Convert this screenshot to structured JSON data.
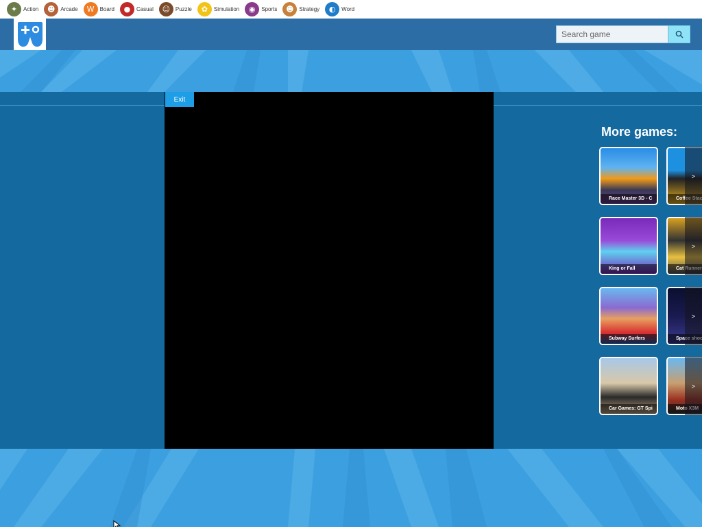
{
  "categories": [
    {
      "label": "Action",
      "icon": "action-icon",
      "color": "#6b7b4a",
      "glyph": "✦"
    },
    {
      "label": "Arcade",
      "icon": "arcade-icon",
      "color": "#b4623a",
      "glyph": "☻"
    },
    {
      "label": "Board",
      "icon": "board-icon",
      "color": "#f07a22",
      "glyph": "W"
    },
    {
      "label": "Casual",
      "icon": "casual-icon",
      "color": "#c22a2a",
      "glyph": "●"
    },
    {
      "label": "Puzzle",
      "icon": "puzzle-icon",
      "color": "#7a4a2a",
      "glyph": "☺"
    },
    {
      "label": "Simulation",
      "icon": "simulation-icon",
      "color": "#f2c418",
      "glyph": "✿"
    },
    {
      "label": "Sports",
      "icon": "sports-icon",
      "color": "#8a3a8a",
      "glyph": "◉"
    },
    {
      "label": "Strategy",
      "icon": "strategy-icon",
      "color": "#c7813a",
      "glyph": "☻"
    },
    {
      "label": "Word",
      "icon": "word-icon",
      "color": "#1e7cc8",
      "glyph": "◐"
    }
  ],
  "search": {
    "placeholder": "Search game"
  },
  "player": {
    "exit_label": "Exit"
  },
  "sidebar": {
    "title": "More games:",
    "games": [
      {
        "title": "Race Master 3D - C",
        "column": 1,
        "art": "linear-gradient(180deg,#2a8de6 0%,#5fb3f0 35%,#f29a18 55%,#3a3a55 75%,#6a3a8a 100%)"
      },
      {
        "title": "Coffee Stack",
        "column": 2,
        "art": "linear-gradient(180deg,#1e90e0 0%,#1e90e0 40%,#222 55%,#e8b020 100%)"
      },
      {
        "title": "King or Fall",
        "column": 1,
        "art": "linear-gradient(180deg,#7a2ab8 0%,#9a4ad8 40%,#5fd0f0 60%,#7a2ab8 100%)"
      },
      {
        "title": "Cat Runner",
        "column": 2,
        "art": "linear-gradient(180deg,#d8a020 0%,#333 40%,#e8c040 70%,#555 100%)"
      },
      {
        "title": "Subway Surfers",
        "column": 1,
        "art": "linear-gradient(180deg,#6ab8f0 0%,#8a6ad0 35%,#e8a060 55%,#d83030 80%,#2a5ab0 100%)"
      },
      {
        "title": "Space shooter",
        "column": 2,
        "art": "linear-gradient(180deg,#0a1030 0%,#1a1a50 50%,#3a3a90 100%)"
      },
      {
        "title": "Car Games: GT Spi",
        "column": 1,
        "art": "linear-gradient(180deg,#a8c8e8 0%,#d8c8a8 45%,#2a2a2a 70%,#b8a080 100%)"
      },
      {
        "title": "Moto X3M",
        "column": 2,
        "art": "linear-gradient(180deg,#6ab8f0 0%,#c8a070 45%,#9a3020 75%,#333 100%)"
      }
    ]
  },
  "colors": {
    "accent": "#1d9ee6",
    "header": "#2c6da5",
    "main": "#14699f"
  }
}
